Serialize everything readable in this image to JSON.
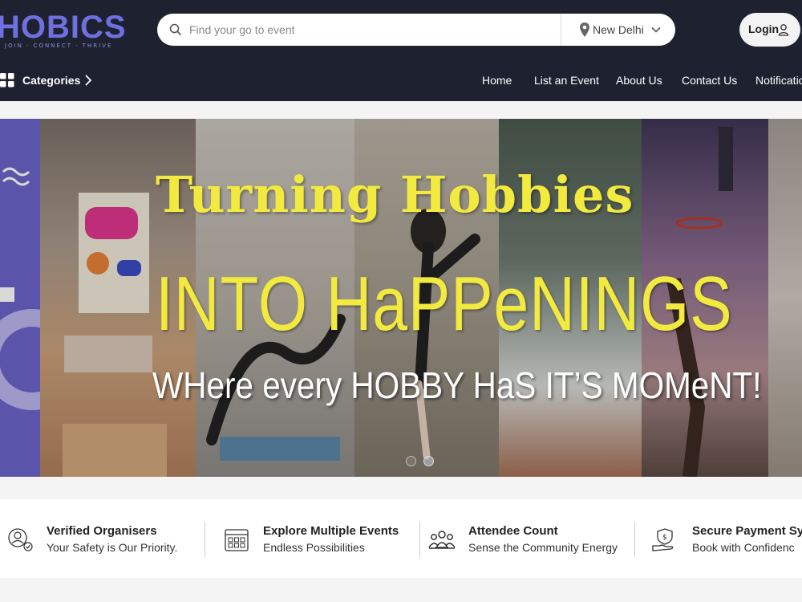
{
  "header": {
    "logo_text": "HOBICS",
    "logo_tagline": "JOIN · CONNECT · THRIVE",
    "search_placeholder": "Find your go to event",
    "location": "New Delhi",
    "login_label": "Login",
    "categories_label": "Categories"
  },
  "nav": {
    "items": [
      "Home",
      "List an Event",
      "About Us",
      "Contact Us",
      "Notificatio"
    ]
  },
  "hero": {
    "line1": "Turning Hobbies",
    "line2": "INTO HaPPeNINGS",
    "line3": "WHere every HOBBY HaS IT’S MOMeNT!",
    "active_slide": 2,
    "slide_count": 2
  },
  "features": [
    {
      "title": "Verified Organisers",
      "subtitle": "Your Safety is Our Priority.",
      "icon": "verified-organiser-icon"
    },
    {
      "title": "Explore Multiple Events",
      "subtitle": "Endless Possibilities",
      "icon": "calendar-grid-icon"
    },
    {
      "title": "Attendee Count",
      "subtitle": "Sense the Community Energy",
      "icon": "people-group-icon"
    },
    {
      "title": "Secure Payment Sy",
      "subtitle": "Book with Confidenc",
      "icon": "secure-payment-icon"
    }
  ],
  "colors": {
    "header_bg": "#1e2230",
    "brand": "#6f6fe0",
    "hero_text": "#f2ea3e"
  }
}
